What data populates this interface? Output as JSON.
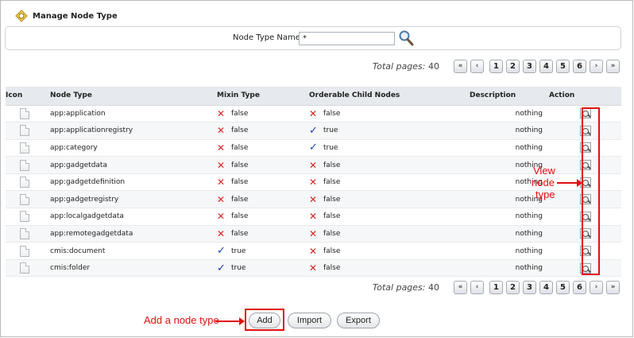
{
  "header": {
    "title": "Manage Node Type"
  },
  "search": {
    "label": "Node Type Name",
    "value": "*"
  },
  "pager": {
    "total_label": "Total pages:",
    "total_value": "40",
    "first": "«",
    "prev": "‹",
    "pages": [
      "1",
      "2",
      "3",
      "4",
      "5",
      "6"
    ],
    "next": "›",
    "last": "»"
  },
  "table": {
    "columns": [
      "Icon",
      "Node Type",
      "Mixin Type",
      "Orderable Child Nodes",
      "Description",
      "Action"
    ],
    "rows": [
      {
        "node_type": "app:application",
        "mixin": "false",
        "orderable": "false",
        "description": "nothing"
      },
      {
        "node_type": "app:applicationregistry",
        "mixin": "false",
        "orderable": "true",
        "description": "nothing"
      },
      {
        "node_type": "app:category",
        "mixin": "false",
        "orderable": "true",
        "description": "nothing"
      },
      {
        "node_type": "app:gadgetdata",
        "mixin": "false",
        "orderable": "false",
        "description": "nothing"
      },
      {
        "node_type": "app:gadgetdefinition",
        "mixin": "false",
        "orderable": "false",
        "description": "nothing"
      },
      {
        "node_type": "app:gadgetregistry",
        "mixin": "false",
        "orderable": "false",
        "description": "nothing"
      },
      {
        "node_type": "app:localgadgetdata",
        "mixin": "false",
        "orderable": "false",
        "description": "nothing"
      },
      {
        "node_type": "app:remotegadgetdata",
        "mixin": "false",
        "orderable": "false",
        "description": "nothing"
      },
      {
        "node_type": "cmis:document",
        "mixin": "true",
        "orderable": "false",
        "description": "nothing"
      },
      {
        "node_type": "cmis:folder",
        "mixin": "true",
        "orderable": "false",
        "description": "nothing"
      }
    ]
  },
  "annotations": {
    "view_label_1": "View",
    "view_label_2": "node",
    "view_label_3": "type",
    "add_label": "Add a node type"
  },
  "buttons": {
    "add": "Add",
    "import": "Import",
    "export": "Export"
  },
  "icons": {
    "title": "diamond-node-icon",
    "search": "magnifier-icon",
    "row": "file-icon",
    "action": "view-magnifier-icon",
    "false_mark": "red-x-icon",
    "true_mark": "blue-check-icon"
  },
  "colors": {
    "annotation": "#e01010",
    "false_mark": "#d22424",
    "true_mark": "#1b3fb0"
  }
}
